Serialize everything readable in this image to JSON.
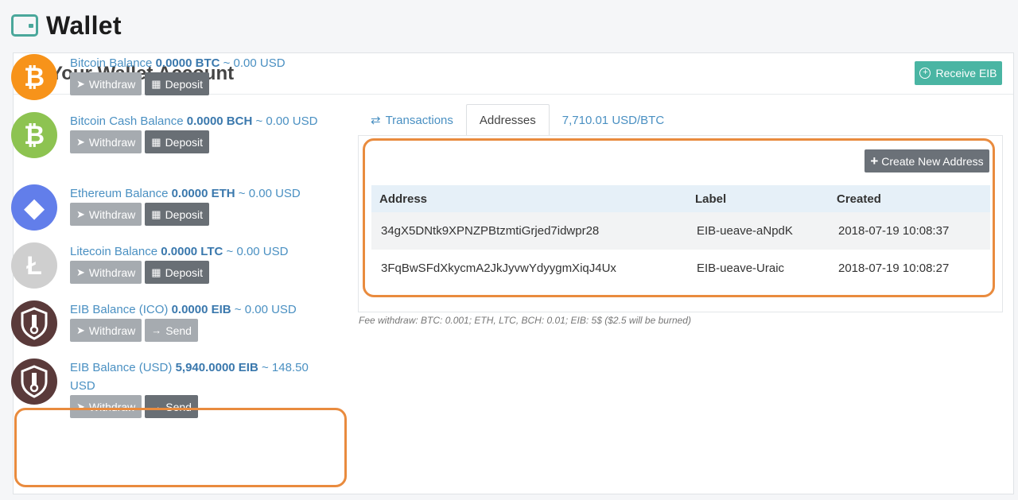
{
  "page": {
    "title": "Wallet"
  },
  "panel": {
    "title": "Your Wallet Account",
    "receive_label": "Receive EIB"
  },
  "coins": [
    {
      "logo": "bitcoin-logo",
      "glyph": "₿",
      "color": "#f7931a",
      "name": "Bitcoin Balance",
      "amount": "0.0000 BTC",
      "usd": "~ 0.00 USD",
      "primary": "Withdraw",
      "secondary": "Deposit"
    },
    {
      "logo": "bitcoin-cash-logo",
      "glyph": "₿",
      "color": "#8dc351",
      "name": "Bitcoin Cash Balance",
      "amount": "0.0000 BCH",
      "usd": "~ 0.00 USD",
      "primary": "Withdraw",
      "secondary": "Deposit"
    },
    {
      "logo": "ethereum-logo",
      "glyph": "◆",
      "color": "#627eea",
      "name": "Ethereum Balance",
      "amount": "0.0000 ETH",
      "usd": "~ 0.00 USD",
      "primary": "Withdraw",
      "secondary": "Deposit"
    },
    {
      "logo": "litecoin-logo",
      "glyph": "Ł",
      "color": "#cfcfcf",
      "name": "Litecoin Balance",
      "amount": "0.0000 LTC",
      "usd": "~ 0.00 USD",
      "primary": "Withdraw",
      "secondary": "Deposit"
    },
    {
      "logo": "eib-logo",
      "glyph": "",
      "color": "#5a3a3a",
      "name": "EIB Balance (ICO)",
      "amount": "0.0000 EIB",
      "usd": "~ 0.00 USD",
      "primary": "Withdraw",
      "secondary": "Send"
    },
    {
      "logo": "eib-logo",
      "glyph": "",
      "color": "#5a3a3a",
      "name": "EIB Balance (USD)",
      "amount": "5,940.0000 EIB",
      "usd": "~ 148.50 USD",
      "primary": "Withdraw",
      "secondary": "Send"
    }
  ],
  "tabs": [
    {
      "label": "Transactions",
      "icon": "swap-arrows-icon"
    },
    {
      "label": "Addresses"
    },
    {
      "label": "7,710.01 USD/BTC"
    }
  ],
  "addresses": {
    "create_label": "Create New Address",
    "headers": [
      "Address",
      "Label",
      "Created"
    ],
    "rows": [
      [
        "34gX5DNtk9XPNZPBtzmtiGrjed7idwpr28",
        "EIB-ueave-aNpdK",
        "2018-07-19 10:08:37"
      ],
      [
        "3FqBwSFdXkycmA2JkJyvwYdyygmXiqJ4Ux",
        "EIB-ueave-Uraic",
        "2018-07-19 10:08:27"
      ]
    ]
  },
  "fee_note": "Fee withdraw: BTC: 0.001; ETH, LTC, BCH: 0.01; EIB: 5$ ($2.5 will be burned)"
}
